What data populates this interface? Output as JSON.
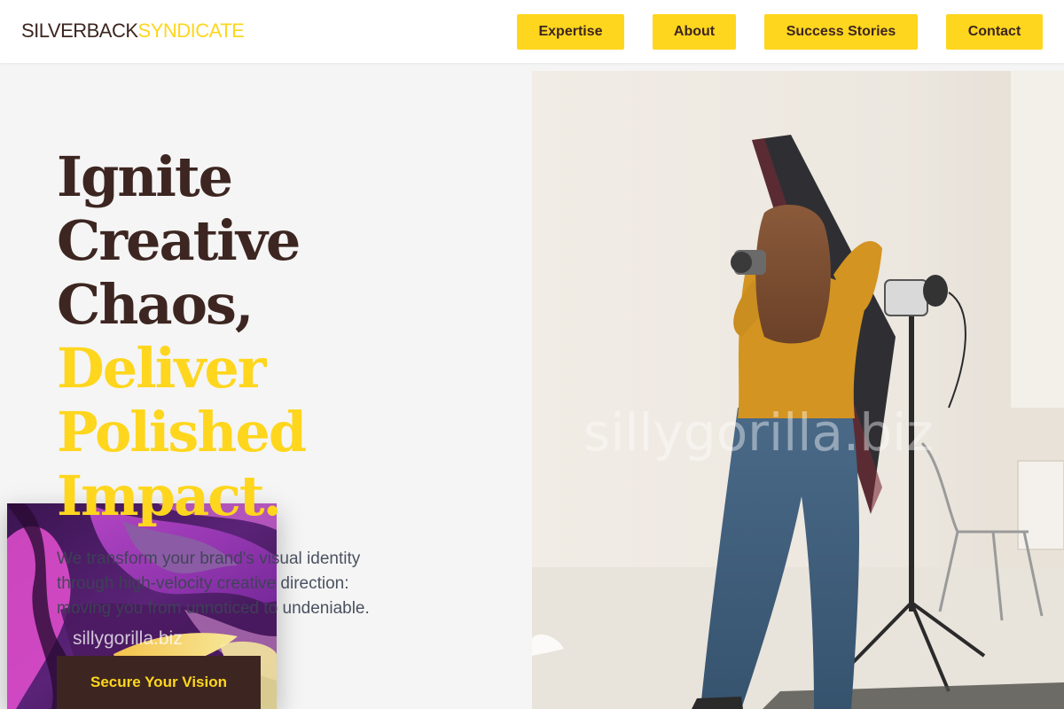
{
  "brand": {
    "first": "SILVERBACK",
    "second": "SYNDICATE"
  },
  "nav": {
    "expertise": "Expertise",
    "about": "About",
    "success_stories": "Success Stories",
    "contact": "Contact"
  },
  "hero": {
    "title_lines": [
      "Ignite",
      "Creative",
      "Chaos,"
    ],
    "title_highlight_lines": [
      "Deliver",
      "Polished",
      "Impact."
    ],
    "description_lines": [
      "We transform your brand's visual identity",
      "through high-velocity creative direction:",
      "moving you from unnoticed to undeniable."
    ],
    "cta": "Secure Your Vision"
  },
  "watermarks": {
    "photo": "sillygorilla.biz",
    "art": "sillygorilla.biz"
  },
  "colors": {
    "brand_dark": "#3d2621",
    "accent_yellow": "#fed61e",
    "text_gray": "#3c4454",
    "background": "#f5f5f5"
  },
  "images": {
    "hero_photo": "photographer-in-white-studio",
    "art_card": "abstract-purple-swirl-art"
  }
}
